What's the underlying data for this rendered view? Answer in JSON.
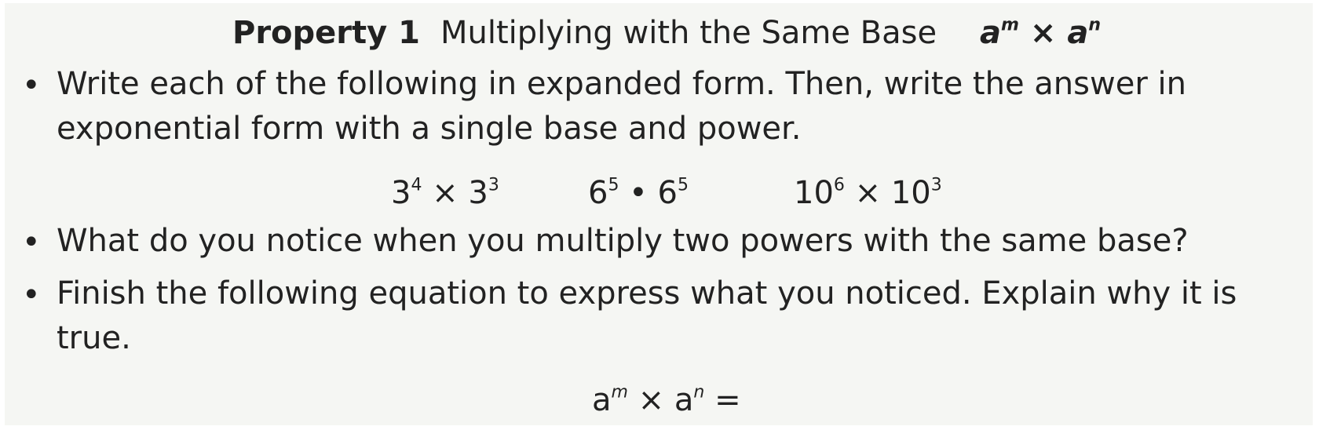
{
  "property": {
    "label": "Property 1",
    "title": "Multiplying with the Same Base",
    "formula": {
      "base1": "a",
      "exp1": "m",
      "op": "×",
      "base2": "a",
      "exp2": "n"
    }
  },
  "bullets": [
    {
      "symbol": "•",
      "text": "Write each of the following in expanded form. Then, write the answer in exponential form with a single base and power."
    },
    {
      "symbol": "•",
      "text": "What do you notice when you multiply two powers with the same base?"
    },
    {
      "symbol": "•",
      "text": "Finish the following equation to express what you noticed. Explain why it is true."
    }
  ],
  "expressions": [
    {
      "base1": "3",
      "exp1": "4",
      "op": "×",
      "base2": "3",
      "exp2": "3"
    },
    {
      "base1": "6",
      "exp1": "5",
      "op": "•",
      "base2": "6",
      "exp2": "5"
    },
    {
      "base1": "10",
      "exp1": "6",
      "op": "×",
      "base2": "10",
      "exp2": "3"
    }
  ],
  "final_equation": {
    "base1": "a",
    "exp1": "m",
    "op": "×",
    "base2": "a",
    "exp2": "n",
    "eq": "="
  }
}
